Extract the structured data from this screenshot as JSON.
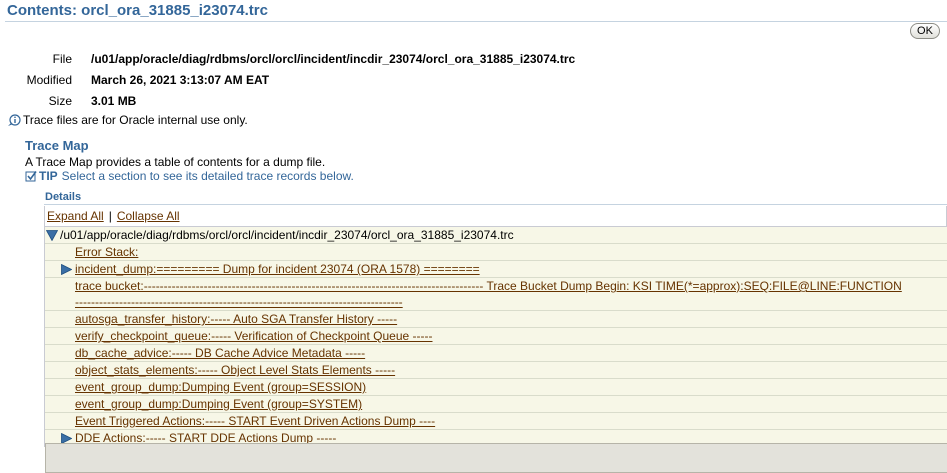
{
  "page": {
    "title": "Contents: orcl_ora_31885_i23074.trc",
    "ok_label": "OK"
  },
  "info": {
    "file_label": "File",
    "file_value": "/u01/app/oracle/diag/rdbms/orcl/orcl/incident/incdir_23074/orcl_ora_31885_i23074.trc",
    "modified_label": "Modified",
    "modified_value": "March 26, 2021 3:13:07 AM EAT",
    "size_label": "Size",
    "size_value": "3.01 MB"
  },
  "note": "Trace files are for Oracle internal use only.",
  "trace_map": {
    "heading": "Trace Map",
    "description": "A Trace Map provides a table of contents for a dump file.",
    "tip_label": "TIP",
    "tip_text": "Select a section to see its detailed trace records below."
  },
  "details": {
    "heading": "Details",
    "expand_all": "Expand All",
    "collapse_all": "Collapse All",
    "separator": "|",
    "root_path": "/u01/app/oracle/diag/rdbms/orcl/orcl/incident/incdir_23074/orcl_ora_31885_i23074.trc",
    "rows": [
      {
        "label": "Error Stack:"
      },
      {
        "label": "incident_dump:========= Dump for incident 23074 (ORA 1578) ========"
      },
      {
        "label": "trace bucket:------------------------------------------------------------------------------------- Trace Bucket Dump Begin: KSI TIME(*=approx):SEQ:FILE@LINE:FUNCTION",
        "label_cont": "----------------------------------------------------------------------------------"
      },
      {
        "label": "autosga_transfer_history:----- Auto SGA Transfer History -----"
      },
      {
        "label": "verify_checkpoint_queue:----- Verification of Checkpoint Queue -----"
      },
      {
        "label": "db_cache_advice:----- DB Cache Advice Metadata -----"
      },
      {
        "label": "object_stats_elements:----- Object Level Stats Elements -----"
      },
      {
        "label": "event_group_dump:Dumping Event (group=SESSION)"
      },
      {
        "label": "event_group_dump:Dumping Event (group=SYSTEM)"
      },
      {
        "label": "Event Triggered Actions:----- START Event Driven Actions Dump ----"
      },
      {
        "label": "DDE Actions:----- START DDE Actions Dump -----"
      }
    ]
  },
  "colors": {
    "heading_blue": "#336699",
    "link_brown": "#663300",
    "tree_background": "#f7f7e7",
    "expander_blue": "#3a6ea5"
  }
}
